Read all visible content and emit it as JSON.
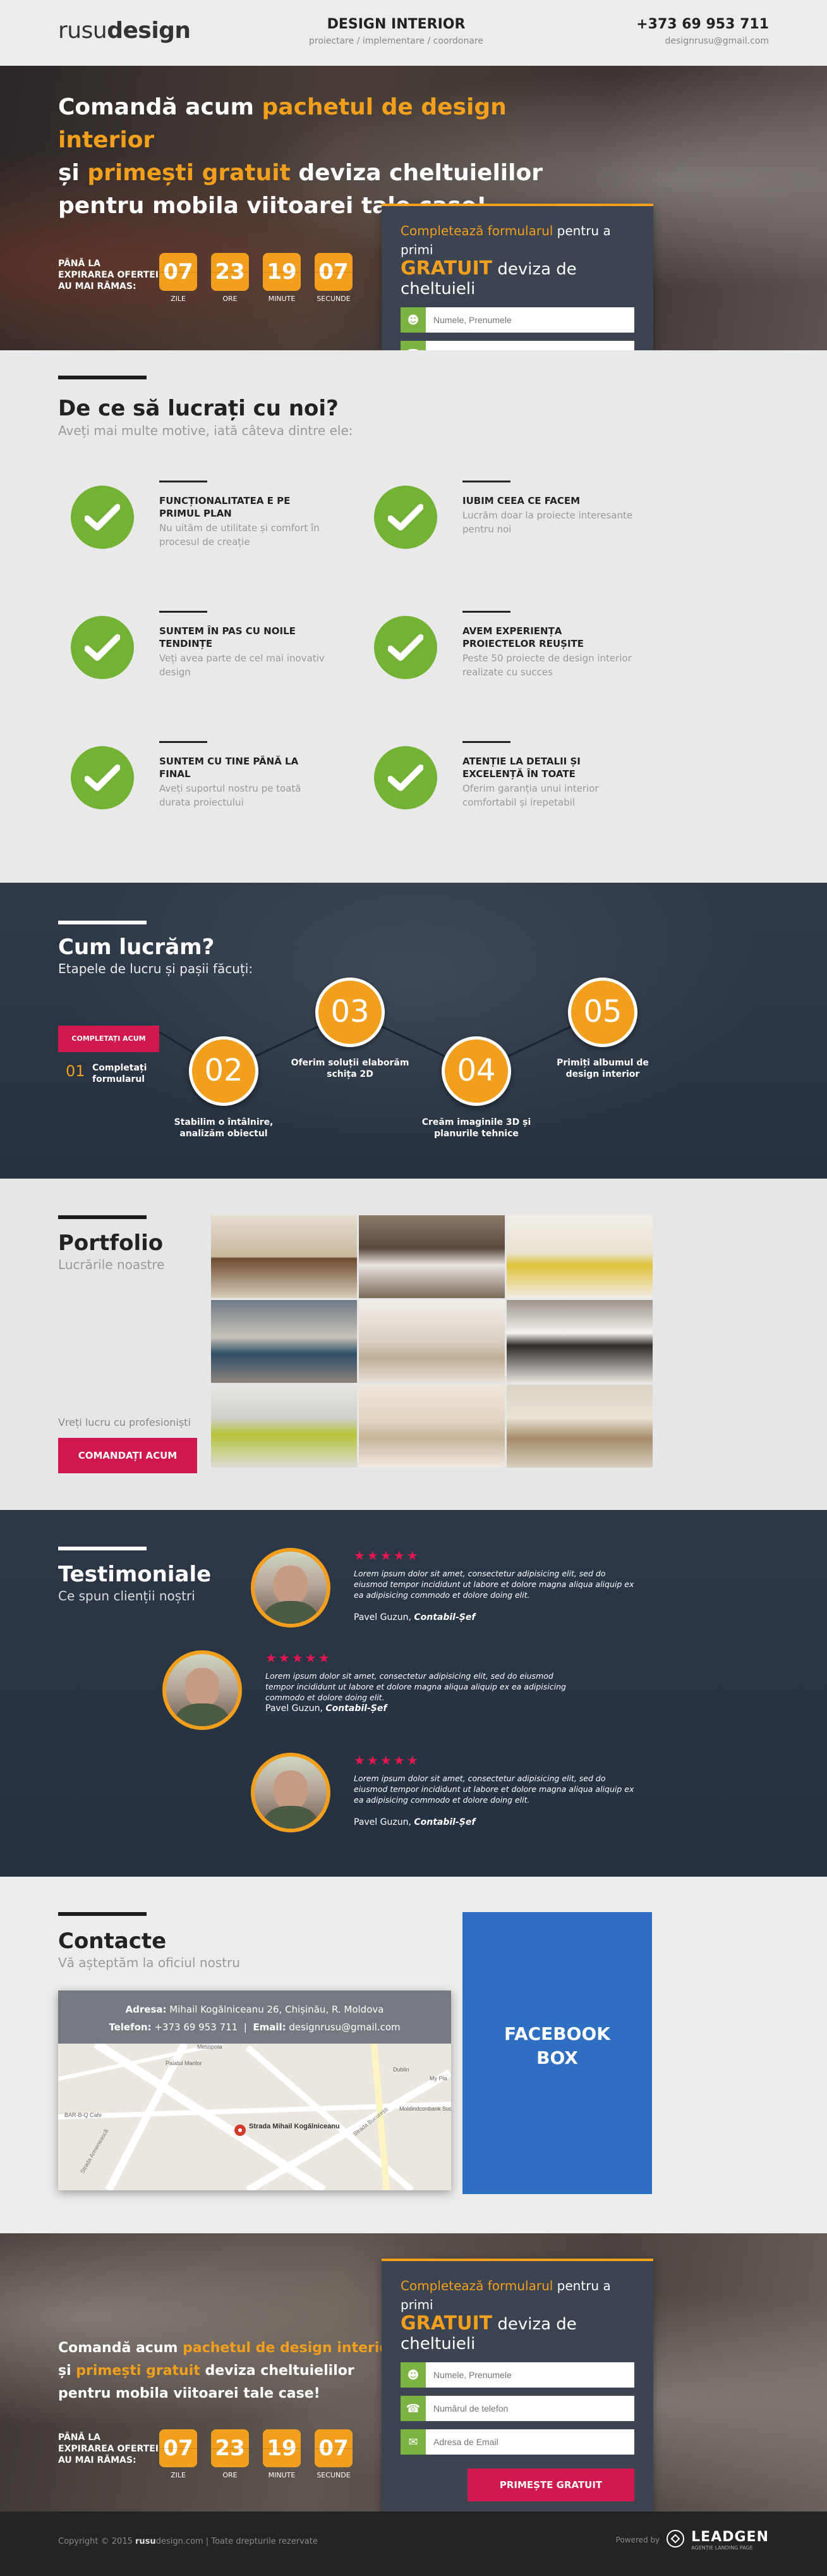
{
  "header": {
    "logo_light": "rusu",
    "logo_bold": "design",
    "title": "DESIGN INTERIOR",
    "subtitle": "proiectare / implementare / coordonare",
    "phone": "+373 69 953 711",
    "email": "designrusu@gmail.com"
  },
  "hero": {
    "line1_a": "Comandă acum ",
    "line1_b": "pachetul de design interior",
    "line2_a": "și ",
    "line2_b": "primești gratuit",
    "line2_c": " deviza cheltuielilor",
    "line3": "pentru mobila viitoarei tale case!",
    "timer_label": "PÂNĂ LA EXPIRAREA OFERTEI AU MAI RĂMAS:",
    "timer": [
      {
        "value": "07",
        "label": "ZILE"
      },
      {
        "value": "23",
        "label": "ORE"
      },
      {
        "value": "19",
        "label": "MINUTE"
      },
      {
        "value": "07",
        "label": "SECUNDE"
      }
    ]
  },
  "form": {
    "title_a": "Completează formularul",
    "title_b": " pentru a primi",
    "title_c": "GRATUIT",
    "title_d": " deviza de cheltuieli",
    "name_placeholder": "Numele, Prenumele",
    "phone_placeholder": "Numărul de telefon",
    "email_placeholder": "Adresa de Email",
    "submit": "PRIMEȘTE GRATUIT"
  },
  "why": {
    "title": "De ce să lucrați cu noi?",
    "subtitle": "Aveți mai multe motive, iată câteva dintre ele:",
    "items": [
      {
        "title": "FUNCȚIONALITATEA E PE PRIMUL PLAN",
        "desc": "Nu uităm de utilitate și comfort în procesul de creație"
      },
      {
        "title": "IUBIM CEEA CE FACEM",
        "desc": "Lucrăm doar la proiecte interesante pentru noi"
      },
      {
        "title": "SUNTEM ÎN PAS CU NOILE TENDINȚE",
        "desc": "Veți avea parte de cel mai inovativ design"
      },
      {
        "title": "AVEM EXPERIENȚA PROIECTELOR REUȘITE",
        "desc": "Peste 50 proiecte de design interior realizate cu succes"
      },
      {
        "title": "SUNTEM CU TINE PÂNĂ LA FINAL",
        "desc": "Aveți suportul nostru pe toată durata proiectului"
      },
      {
        "title": "ATENȚIE LA DETALII ȘI EXCELENȚĂ ÎN TOATE",
        "desc": "Oferim garanția unui interior comfortabil și irepetabil"
      }
    ]
  },
  "how": {
    "title": "Cum lucrăm?",
    "subtitle": "Etapele de lucru și pașii făcuți:",
    "badge": "COMPLETAȚI ACUM",
    "steps": [
      {
        "num": "01",
        "label": "Completați formularul"
      },
      {
        "num": "02",
        "label": "Stabilim o întâlnire, analizăm obiectul"
      },
      {
        "num": "03",
        "label": "Oferim soluții elaborăm schița 2D"
      },
      {
        "num": "04",
        "label": "Creăm imaginile 3D și planurile tehnice"
      },
      {
        "num": "05",
        "label": "Primiți albumul de design interior"
      }
    ]
  },
  "portfolio": {
    "title": "Portfolio",
    "subtitle": "Lucrările noastre",
    "cta_text": "Vreți lucru cu profesioniști",
    "button": "COMANDAȚI ACUM",
    "tiles": [
      "living-tv",
      "bedroom-dark",
      "kids-room",
      "living-blue",
      "living-bright",
      "bedroom-white",
      "dining-green",
      "living-chandelier",
      "kitchen"
    ]
  },
  "testimonials": {
    "title": "Testimoniale",
    "subtitle": "Ce spun clienții noștri",
    "stars": "★★★★★",
    "items": [
      {
        "quote": "Lorem ipsum dolor sit amet, consectetur adipisicing elit, sed do eiusmod tempor incididunt ut labore et dolore magna aliqua aliquip ex ea adipisicing commodo et dolore doing elit.",
        "name": "Pavel Guzun, ",
        "role": "Contabil-Șef"
      },
      {
        "quote": "Lorem ipsum dolor sit amet, consectetur adipisicing elit, sed do eiusmod tempor incididunt ut labore et dolore magna aliqua aliquip ex ea adipisicing commodo et dolore doing elit.",
        "name": "Pavel Guzun, ",
        "role": "Contabil-Șef"
      },
      {
        "quote": "Lorem ipsum dolor sit amet, consectetur adipisicing elit, sed do eiusmod tempor incididunt ut labore et dolore magna aliqua aliquip ex ea adipisicing commodo et dolore doing elit.",
        "name": "Pavel Guzun, ",
        "role": "Contabil-Șef"
      }
    ]
  },
  "contact": {
    "title": "Contacte",
    "subtitle": "Vă așteptăm la oficiul nostru",
    "address_label": "Adresa:",
    "address": " Mihail Kogălniceanu 26, Chișinău, R. Moldova",
    "phone_label": "Telefon:",
    "phone": " +373 69 953 711",
    "email_label": "Email:",
    "email": " designrusu@gmail.com",
    "map_pin": "Strada Mihail Kogălniceanu",
    "map_labels": [
      "Mesopota",
      "Palatul Marilor",
      "Dublin",
      "My Pla",
      "Moldindconbank Sucursala",
      "BAR-B-Q Cafe",
      "Strada Armenească",
      "Strada București"
    ],
    "facebook_line1": "FACEBOOK",
    "facebook_line2": "BOX"
  },
  "footer": {
    "copyright": "Copyright © 2015 ",
    "brand": "rusu",
    "brand_rest": "design.com",
    "rights": " | Toate drepturile rezervate",
    "powered": "Powered by",
    "leadgen": "LEADGEN",
    "leadgen_sub": "AGENȚIE LANDING PAGE"
  },
  "colors": {
    "accent": "#f29f1d",
    "cta": "#d0184f",
    "check": "#74b236",
    "dark": "#2c3846",
    "facebook": "#2f6fc3"
  }
}
